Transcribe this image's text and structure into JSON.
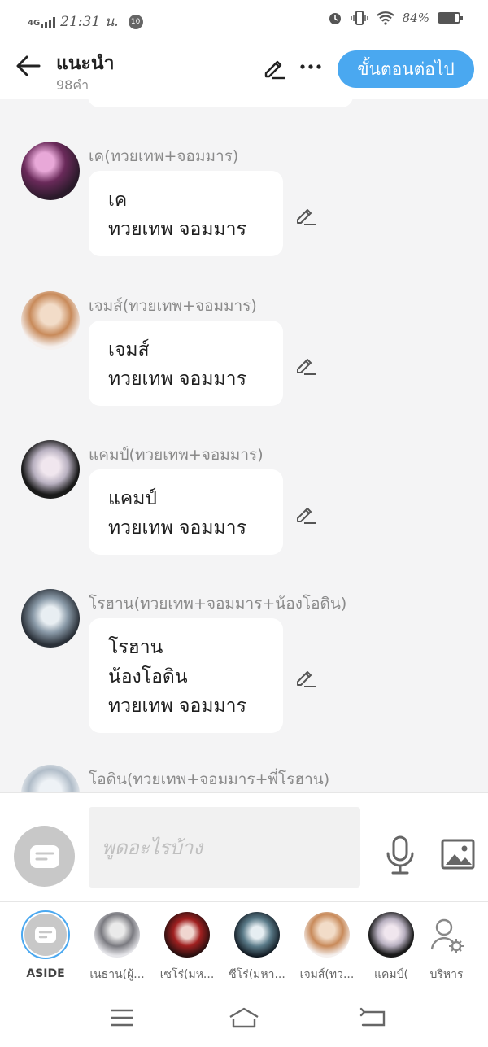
{
  "status_bar": {
    "network": "4G",
    "time": "21:31 น.",
    "notification_count": "10",
    "battery": "84%",
    "battery_level": 0.84
  },
  "header": {
    "back_icon": "arrow-left-icon",
    "title": "แนะนำ",
    "subtitle": "98คำ",
    "edit_icon": "pencil-icon",
    "more_icon": "more-dots-icon",
    "next_label": "ขั้นตอนต่อไป",
    "accent_color": "#4aa8f0"
  },
  "messages": [
    {
      "sender": "เค(ทวยเทพ+จอมมาร)",
      "lines": [
        "เค",
        "ทวยเทพ จอมมาร"
      ]
    },
    {
      "sender": "เจมส์(ทวยเทพ+จอมมาร)",
      "lines": [
        "เจมส์",
        "ทวยเทพ จอมมาร"
      ]
    },
    {
      "sender": "แคมป์(ทวยเทพ+จอมมาร)",
      "lines": [
        "แคมป์",
        "ทวยเทพ จอมมาร"
      ]
    },
    {
      "sender": "โรฮาน(ทวยเทพ+จอมมาร+น้องโอดิน)",
      "lines": [
        "โรฮาน",
        "น้องโอดิน",
        "ทวยเทพ จอมมาร"
      ]
    },
    {
      "sender": "โอดิน(ทวยเทพ+จอมมาร+พี่โรฮาน)",
      "lines": []
    }
  ],
  "composer": {
    "placeholder": "พูดอะไรบ้าง",
    "mic_icon": "microphone-icon",
    "image_icon": "image-icon"
  },
  "characters": [
    {
      "label": "ASIDE",
      "selected": true
    },
    {
      "label": "เนธาน(ผู้..."
    },
    {
      "label": "เซโร่(มห..."
    },
    {
      "label": "ซีโร่(มหา..."
    },
    {
      "label": "เจมส์(ทว..."
    },
    {
      "label": "แคมป์("
    },
    {
      "label": "บริหาร"
    }
  ],
  "navbar": {
    "menu_icon": "menu-icon",
    "home_icon": "home-icon",
    "back_icon": "back-return-icon"
  }
}
